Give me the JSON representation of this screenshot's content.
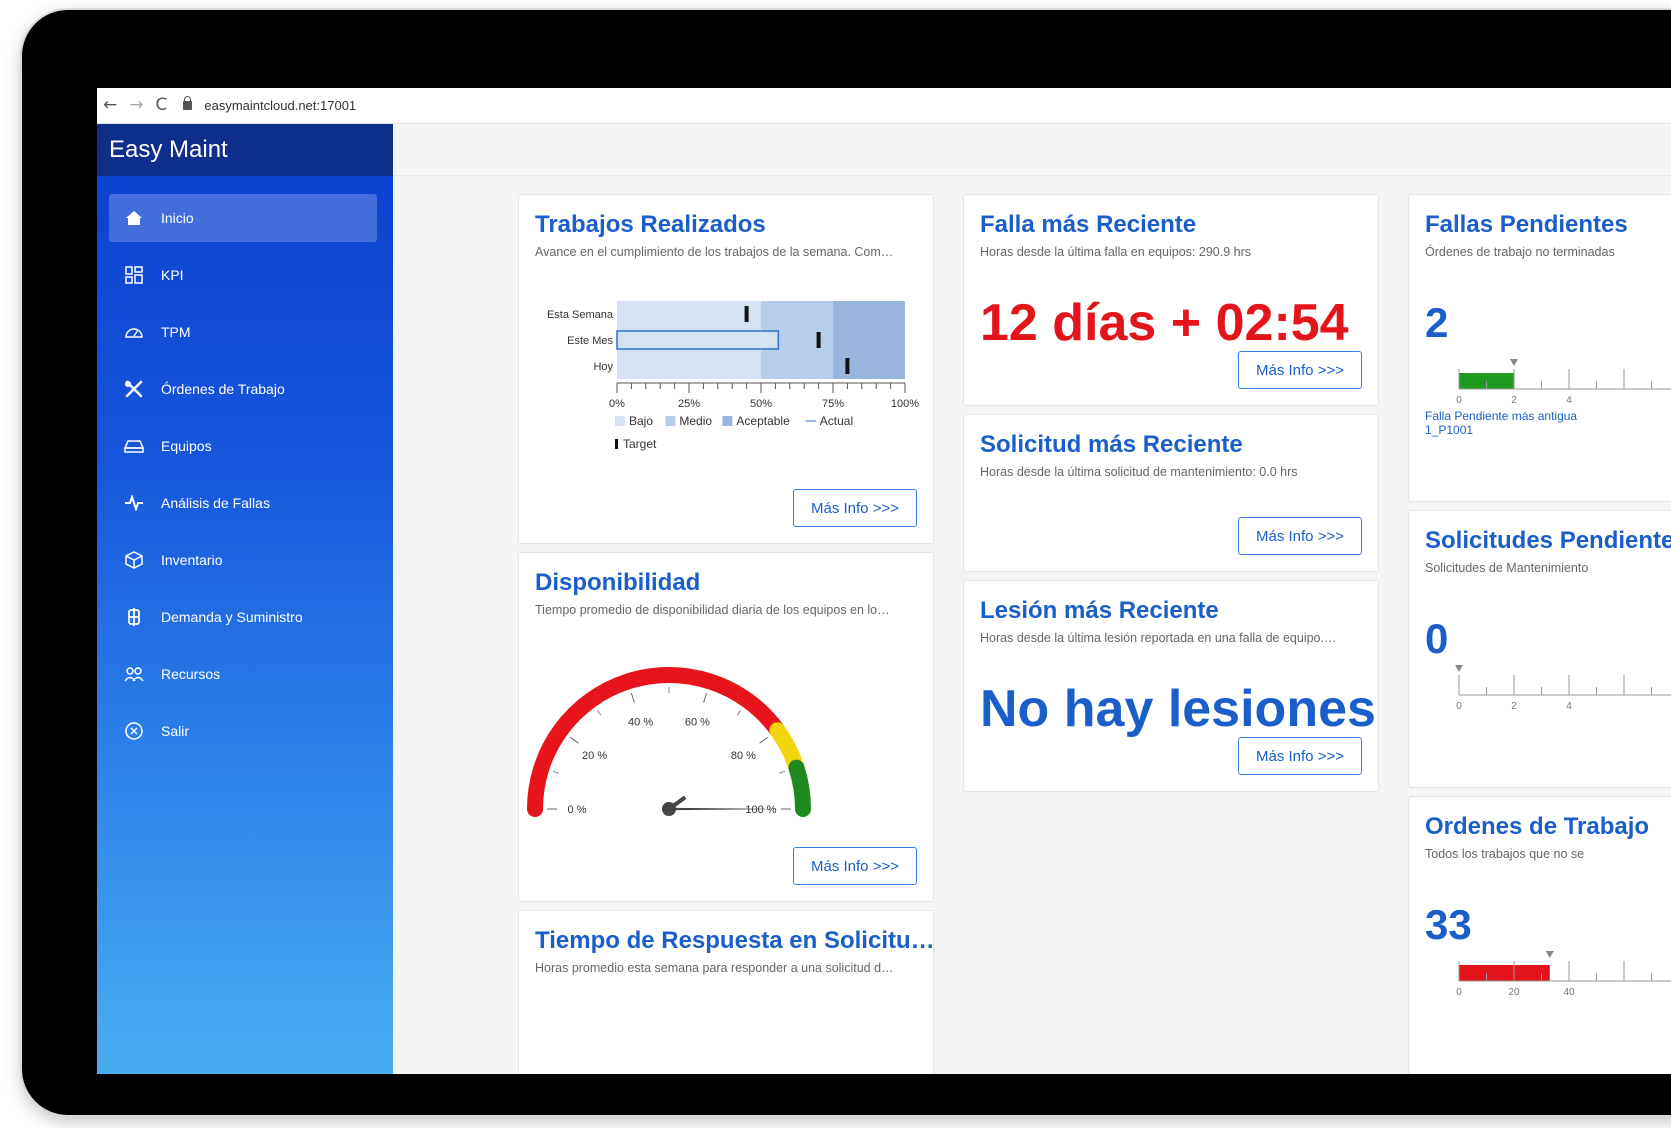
{
  "browser": {
    "url": "easymaintcloud.net:17001"
  },
  "sidebar": {
    "brand": "Easy Maint",
    "items": [
      {
        "label": "Inicio",
        "icon": "home-icon",
        "active": true
      },
      {
        "label": "KPI",
        "icon": "dashboard-grid-icon"
      },
      {
        "label": "TPM",
        "icon": "gauge-icon"
      },
      {
        "label": "Órdenes de Trabajo",
        "icon": "tools-icon"
      },
      {
        "label": "Equipos",
        "icon": "drive-icon"
      },
      {
        "label": "Análisis de Fallas",
        "icon": "pulse-icon"
      },
      {
        "label": "Inventario",
        "icon": "box-icon"
      },
      {
        "label": "Demanda y Suministro",
        "icon": "dollar-icon"
      },
      {
        "label": "Recursos",
        "icon": "people-icon"
      },
      {
        "label": "Salir",
        "icon": "close-circle-icon"
      }
    ]
  },
  "more_info_label": "Más Info >>>",
  "cards": {
    "trabajos": {
      "title": "Trabajos Realizados",
      "subtitle": "Avance en el cumplimiento de los trabajos de la semana. Com…"
    },
    "disponibilidad": {
      "title": "Disponibilidad",
      "subtitle": "Tiempo promedio de disponibilidad diaria de los equipos en lo…"
    },
    "tiempo_respuesta": {
      "title": "Tiempo de Respuesta en Solicitu…",
      "subtitle": "Horas promedio esta semana para responder a una solicitud d…"
    },
    "falla": {
      "title": "Falla más Reciente",
      "subtitle": "Horas desde la última falla en equipos: 290.9 hrs",
      "value": "12 días + 02:54"
    },
    "solicitud": {
      "title": "Solicitud más Reciente",
      "subtitle": "Horas desde la última solicitud de mantenimiento: 0.0 hrs"
    },
    "lesion": {
      "title": "Lesión más Reciente",
      "subtitle": "Horas desde la última lesión reportada en una falla de equipo.…",
      "value": "No hay lesiones"
    },
    "fallas_pendientes": {
      "title": "Fallas Pendientes",
      "subtitle": "Órdenes de trabajo no terminadas",
      "value": "2",
      "note_line1": "Falla Pendiente más antigua",
      "note_line2": "1_P1001",
      "gauge_value": 2,
      "gauge_target": 2,
      "gauge_ticks": [
        "0",
        "2",
        "4"
      ],
      "bar_color": "#1e9a1e"
    },
    "solicitudes_pendientes": {
      "title": "Solicitudes Pendientes",
      "subtitle": "Solicitudes de Mantenimiento",
      "value": "0",
      "gauge_value": 0,
      "gauge_target": 0,
      "gauge_ticks": [
        "0",
        "2",
        "4"
      ]
    },
    "ordenes": {
      "title": "Ordenes de Trabajo",
      "subtitle": "Todos los trabajos que no se",
      "value": "33",
      "gauge_value": 33,
      "gauge_target": 33,
      "gauge_ticks": [
        "0",
        "20",
        "40"
      ],
      "bar_color": "#e4141b"
    }
  },
  "chart_data": [
    {
      "type": "bullet",
      "categories": [
        "Esta Semana",
        "Este Mes",
        "Hoy"
      ],
      "actual": [
        0,
        56,
        0
      ],
      "target": [
        45,
        70,
        80
      ],
      "ranges": {
        "Bajo": 50,
        "Medio": 75,
        "Aceptable": 100
      },
      "range_colors": {
        "Bajo": "#d4e2f2",
        "Medio": "#b7cde9",
        "Aceptable": "#9ab6df"
      },
      "x_ticks": [
        "0%",
        "25%",
        "50%",
        "75%",
        "100%"
      ],
      "xlim": [
        0,
        100
      ],
      "legend": [
        "Bajo",
        "Medio",
        "Aceptable",
        "Actual",
        "Target"
      ]
    },
    {
      "type": "gauge",
      "value": 100,
      "min": 0,
      "max": 100,
      "tick_labels": [
        "0 %",
        "20 %",
        "40 %",
        "60 %",
        "80 %",
        "100 %"
      ],
      "bands": [
        {
          "from": 0,
          "to": 80,
          "color": "#e8141b"
        },
        {
          "from": 80,
          "to": 90,
          "color": "#f2d40c"
        },
        {
          "from": 90,
          "to": 100,
          "color": "#1e8a1e"
        }
      ]
    }
  ]
}
